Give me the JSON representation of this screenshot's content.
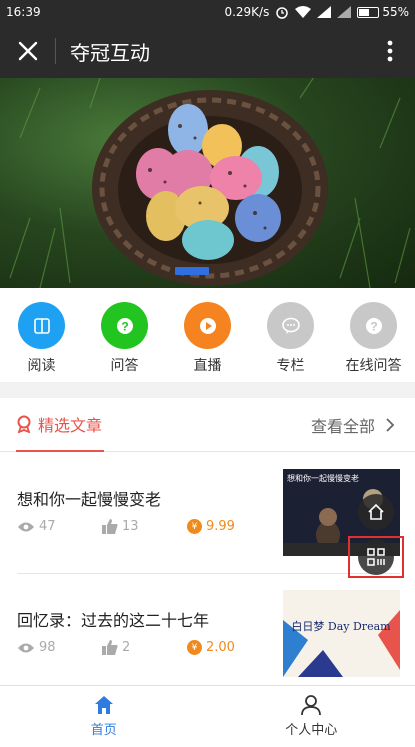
{
  "status": {
    "time": "16:39",
    "speed": "0.29K/s",
    "battery": "55%",
    "battery_level": 0.55
  },
  "header": {
    "title": "夺冠互动"
  },
  "quick_links": [
    {
      "label": "阅读",
      "color": "#1ea1f2",
      "icon": "book-icon"
    },
    {
      "label": "问答",
      "color": "#22c51f",
      "icon": "qa-icon"
    },
    {
      "label": "直播",
      "color": "#f5831f",
      "icon": "play-icon"
    },
    {
      "label": "专栏",
      "color": "#c8c8c8",
      "icon": "chat-icon"
    },
    {
      "label": "在线问答",
      "color": "#c8c8c8",
      "icon": "question-icon"
    }
  ],
  "section": {
    "tab_label": "精选文章",
    "see_all": "查看全部",
    "accent": "#e8544b"
  },
  "articles": [
    {
      "title": "想和你一起慢慢变老",
      "views": "47",
      "likes": "13",
      "price": "9.99",
      "yen": "¥",
      "thumb_text": "想和你一起慢慢变老"
    },
    {
      "title": "回忆录：过去的这二十七年",
      "views": "98",
      "likes": "2",
      "price": "2.00",
      "yen": "¥",
      "thumb_text": "白日梦 Day Dream"
    }
  ],
  "bottom_nav": [
    {
      "label": "首页",
      "active": true
    },
    {
      "label": "个人中心",
      "active": false
    }
  ]
}
